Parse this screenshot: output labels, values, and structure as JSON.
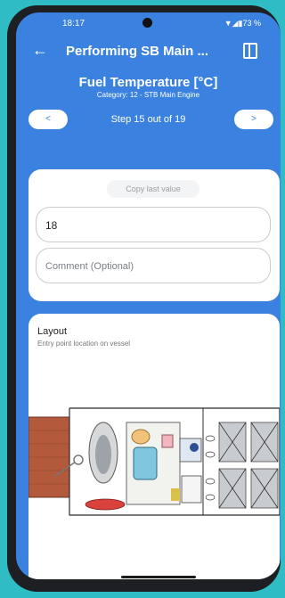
{
  "status": {
    "time": "18:17",
    "indicators": "▼◢▮73 %"
  },
  "appbar": {
    "title": "Performing SB Main ..."
  },
  "measurement": {
    "title": "Fuel Temperature [°C]",
    "category": "Category: 12 - STB Main Engine"
  },
  "stepper": {
    "prev": "<",
    "label": "Step 15 out of 19",
    "next": ">"
  },
  "form": {
    "copy_label": "Copy last value",
    "value": "18",
    "comment_placeholder": "Comment (Optional)"
  },
  "layout": {
    "title": "Layout",
    "subtitle": "Entry point location on vessel"
  }
}
